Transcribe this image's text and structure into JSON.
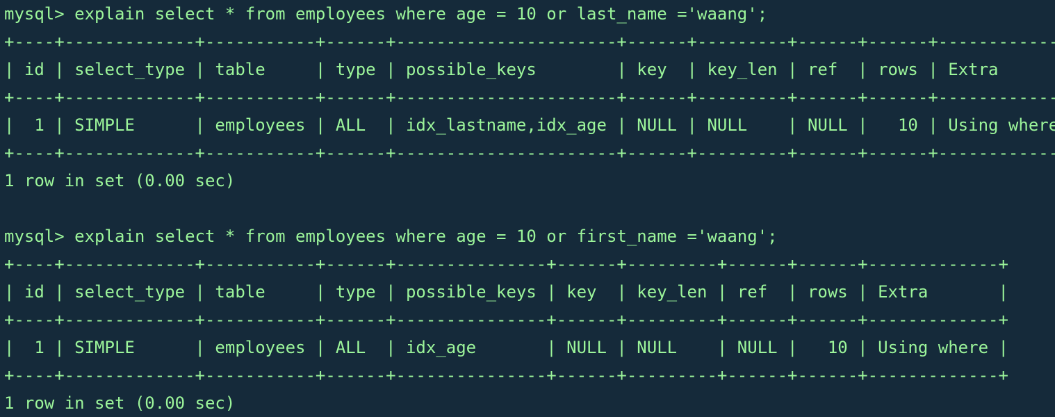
{
  "colors": {
    "background": "#152a3a",
    "text": "#9cf59a"
  },
  "terminal": {
    "block1": {
      "prompt": "mysql> explain select * from employees where age = 10 or last_name ='waang';",
      "sep1": "+----+-------------+-----------+------+----------------------+------+---------+------+------+-------------+",
      "header": "| id | select_type | table     | type | possible_keys        | key  | key_len | ref  | rows | Extra       |",
      "sep2": "+----+-------------+-----------+------+----------------------+------+---------+------+------+-------------+",
      "row": "|  1 | SIMPLE      | employees | ALL  | idx_lastname,idx_age | NULL | NULL    | NULL |   10 | Using where |",
      "sep3": "+----+-------------+-----------+------+----------------------+------+---------+------+------+-------------+",
      "result": "1 row in set (0.00 sec)"
    },
    "block2": {
      "prompt": "mysql> explain select * from employees where age = 10 or first_name ='waang';",
      "sep1": "+----+-------------+-----------+------+---------------+------+---------+------+------+-------------+",
      "header": "| id | select_type | table     | type | possible_keys | key  | key_len | ref  | rows | Extra       |",
      "sep2": "+----+-------------+-----------+------+---------------+------+---------+------+------+-------------+",
      "row": "|  1 | SIMPLE      | employees | ALL  | idx_age       | NULL | NULL    | NULL |   10 | Using where |",
      "sep3": "+----+-------------+-----------+------+---------------+------+---------+------+------+-------------+",
      "result": "1 row in set (0.00 sec)"
    }
  }
}
